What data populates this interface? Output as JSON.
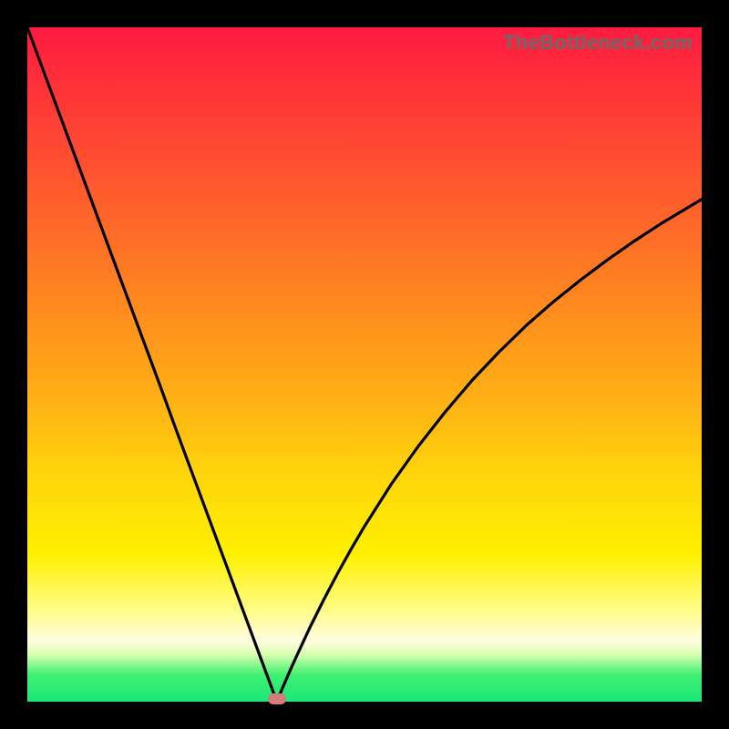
{
  "watermark": "TheBottleneck.com",
  "colors": {
    "frame": "#000000",
    "curve": "#000000",
    "marker": "#d77a7a",
    "gradient_top": "#ff1a40",
    "gradient_bottom": "#18e878"
  },
  "chart_data": {
    "type": "line",
    "title": "",
    "xlabel": "",
    "ylabel": "",
    "xlim": [
      0,
      100
    ],
    "ylim": [
      0,
      100
    ],
    "grid": false,
    "legend": false,
    "x": [
      0,
      2,
      4,
      6,
      8,
      10,
      12,
      14,
      16,
      18,
      20,
      22,
      24,
      26,
      28,
      30,
      32,
      34,
      36,
      37,
      38,
      39,
      40,
      42,
      44,
      46,
      48,
      50,
      54,
      58,
      62,
      66,
      70,
      74,
      78,
      82,
      86,
      90,
      94,
      98,
      100
    ],
    "values": [
      100,
      94.6,
      89.2,
      83.8,
      78.4,
      73.0,
      67.6,
      62.2,
      56.8,
      51.4,
      46.0,
      40.5,
      35.1,
      29.7,
      24.3,
      18.9,
      13.5,
      8.1,
      2.7,
      0,
      2.4,
      4.7,
      6.9,
      11.2,
      15.2,
      19.0,
      22.6,
      26.0,
      32.3,
      37.9,
      43.0,
      47.7,
      51.9,
      55.8,
      59.3,
      62.5,
      65.5,
      68.3,
      70.9,
      73.3,
      74.5
    ],
    "marker": {
      "x": 37,
      "y": 0
    }
  }
}
